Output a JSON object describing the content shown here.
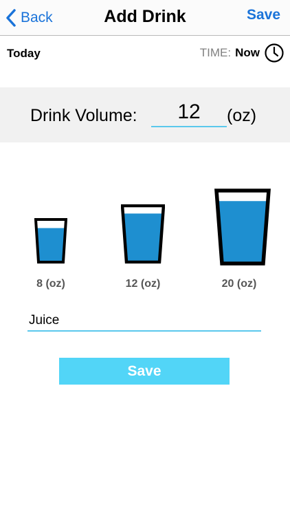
{
  "nav": {
    "back_label": "Back",
    "title": "Add Drink",
    "save_label": "Save"
  },
  "info": {
    "day_label": "Today",
    "time_label": "TIME:",
    "time_value": "Now"
  },
  "volume": {
    "label": "Drink Volume:",
    "value": "12",
    "unit": "(oz)"
  },
  "presets": [
    {
      "label": "8 (oz)",
      "fill_fraction": 0.82
    },
    {
      "label": "12 (oz)",
      "fill_fraction": 0.88
    },
    {
      "label": "20 (oz)",
      "fill_fraction": 0.87
    }
  ],
  "drink_name": {
    "value": "Juice"
  },
  "save_button": {
    "label": "Save"
  },
  "colors": {
    "accent_blue": "#1a73d9",
    "water_blue": "#1e8fd0",
    "underline_cyan": "#5ac8ec",
    "save_button_bg": "#52d5f7",
    "band_gray": "#f1f1f1"
  },
  "icons": {
    "back": "chevron-left-icon",
    "time": "clock-icon",
    "cup": "glass-icon"
  }
}
